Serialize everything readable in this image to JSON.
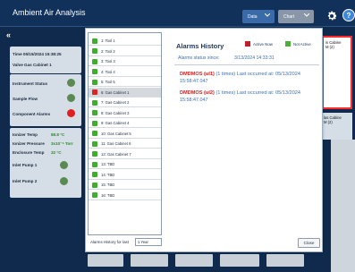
{
  "app": {
    "title": "Ambient Air Analysis",
    "data_label": "Data",
    "chart_label": "Chart",
    "help_label": "?"
  },
  "sidebar": {
    "collapse_glyph": "«",
    "time_text": "Time  05/15/2024 15:38:25",
    "valve_text": "Valve  Gas Cabinet 1",
    "status_rows": [
      {
        "label": "Instrument Status",
        "color": "#5a8a52"
      },
      {
        "label": "Sample Flow",
        "color": "#5a8a52"
      },
      {
        "label": "Component Alarms",
        "color": "#e02020"
      }
    ],
    "env_rows": [
      {
        "label": "Ionizer Temp",
        "value": "88.8 °C"
      },
      {
        "label": "Ionizer Pressure",
        "value": "3x10⁻⁶ Torr"
      },
      {
        "label": "Enclosure Temp",
        "value": "32 °C"
      }
    ],
    "pump_rows": [
      {
        "label": "Inlet Pump 1",
        "color": "#5a8a52"
      },
      {
        "label": "Inlet Pump 2",
        "color": "#5a8a52"
      }
    ]
  },
  "background": {
    "right_panel_text": "is Cabine\nM (2)",
    "right_panel2_text": "las Cabine\nM (2)"
  },
  "dialog": {
    "list": [
      {
        "label": "1: Tool 1",
        "status": "green"
      },
      {
        "label": "2: Tool 2",
        "status": "green"
      },
      {
        "label": "3: Tool 3",
        "status": "green"
      },
      {
        "label": "4: Tool 4",
        "status": "green"
      },
      {
        "label": "5: Tool 5",
        "status": "green"
      },
      {
        "label": "6: Gas Cabinet 1",
        "status": "red",
        "selected": true
      },
      {
        "label": "7: Gas Cabinet 2",
        "status": "green"
      },
      {
        "label": "8: Gas Cabinet 3",
        "status": "green"
      },
      {
        "label": "9: Gas Cabinet 4",
        "status": "green"
      },
      {
        "label": "10: Gas Cabinet 5",
        "status": "green"
      },
      {
        "label": "11: Gas Cabinet 6",
        "status": "green"
      },
      {
        "label": "12: Gas Cabinet 7",
        "status": "green"
      },
      {
        "label": "13: TBD",
        "status": "green"
      },
      {
        "label": "14: TBD",
        "status": "green"
      },
      {
        "label": "15: TBD",
        "status": "green"
      },
      {
        "label": "16: TBD",
        "status": "green"
      }
    ],
    "alarms_title": "Alarms History",
    "legend_active": "Active Now",
    "legend_not_active": "Not Active",
    "legend_active_color": "#c0202a",
    "legend_not_active_color": "#4caf3a",
    "since_label": "Alarms status since:",
    "since_value": "3/13/2024 14:33:31",
    "alarms": [
      {
        "code": "DMDMOS (ul1)",
        "count": "(1 times)",
        "last_label": "Last occurred at: 05/13/2024",
        "time": "15:58:47.047"
      },
      {
        "code": "DMDMOS (ul2)",
        "count": "(1 times)",
        "last_label": "Last occurred at: 05/13/2024",
        "time": "15:58:47.047"
      }
    ],
    "footer_label": "Alarms History for last",
    "footer_select": "1 Year",
    "close_label": "Close"
  }
}
